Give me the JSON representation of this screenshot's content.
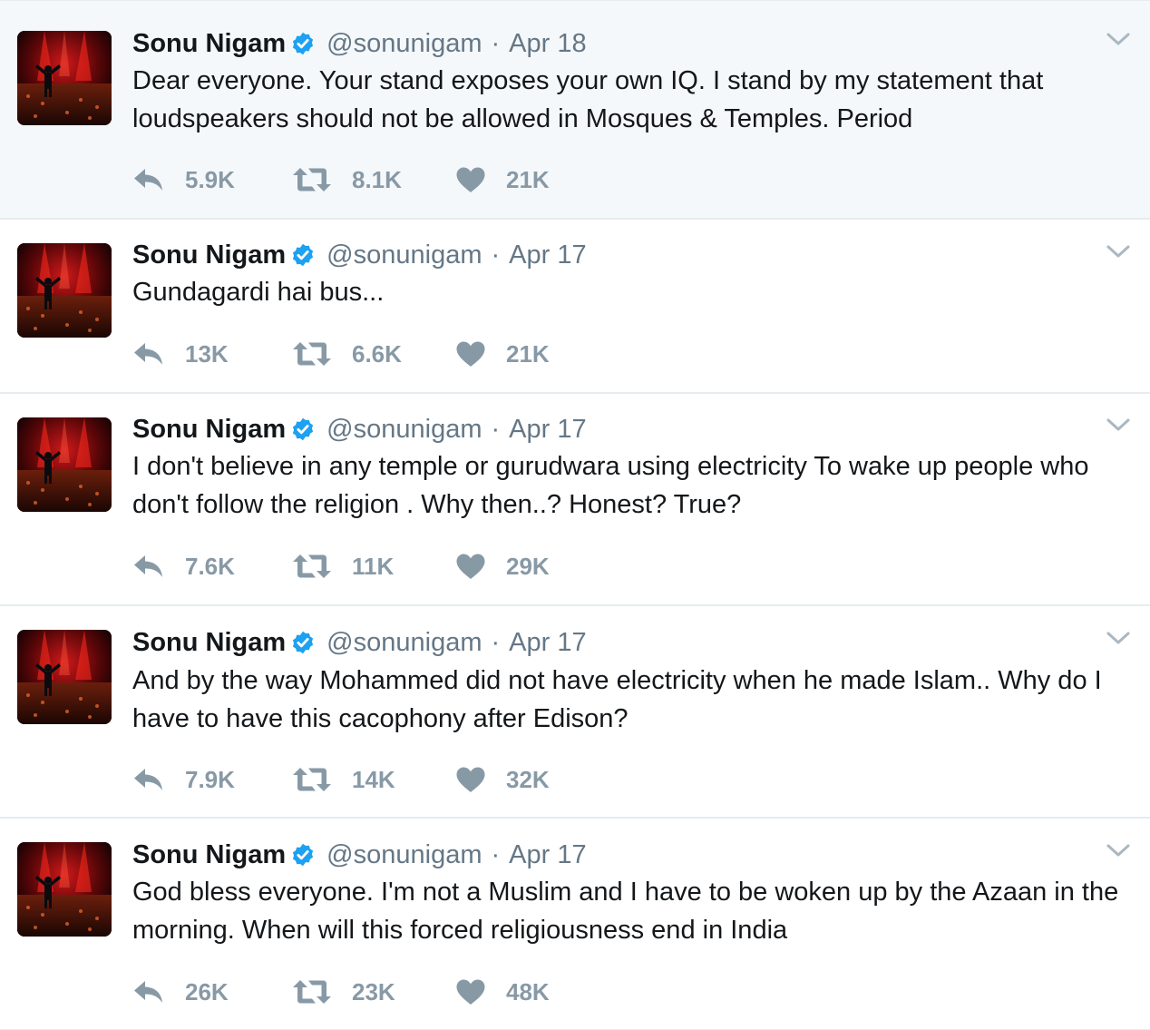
{
  "tweets": [
    {
      "name": "Sonu Nigam",
      "handle": "@sonunigam",
      "separator": "·",
      "date": "Apr 18",
      "text": "Dear everyone. Your stand exposes your own IQ. I stand by my statement that loudspeakers should not be allowed in Mosques & Temples. Period",
      "replies": "5.9K",
      "retweets": "8.1K",
      "likes": "21K",
      "highlighted": true
    },
    {
      "name": "Sonu Nigam",
      "handle": "@sonunigam",
      "separator": "·",
      "date": "Apr 17",
      "text": "Gundagardi hai bus...",
      "replies": "13K",
      "retweets": "6.6K",
      "likes": "21K",
      "highlighted": false
    },
    {
      "name": "Sonu Nigam",
      "handle": "@sonunigam",
      "separator": "·",
      "date": "Apr 17",
      "text": "I don't believe in any temple or gurudwara using electricity To wake up people who don't follow the religion . Why then..? Honest? True?",
      "replies": "7.6K",
      "retweets": "11K",
      "likes": "29K",
      "highlighted": false
    },
    {
      "name": "Sonu Nigam",
      "handle": "@sonunigam",
      "separator": "·",
      "date": "Apr 17",
      "text": "And by the way Mohammed did not have electricity when he made Islam.. Why do I have to have this cacophony after Edison?",
      "replies": "7.9K",
      "retweets": "14K",
      "likes": "32K",
      "highlighted": false
    },
    {
      "name": "Sonu Nigam",
      "handle": "@sonunigam",
      "separator": "·",
      "date": "Apr 17",
      "text": "God bless everyone. I'm not a Muslim and I have to be woken up by the Azaan in the morning. When will this forced religiousness end in India",
      "replies": "26K",
      "retweets": "23K",
      "likes": "48K",
      "highlighted": false
    }
  ],
  "icons": {
    "verified": "verified-badge-icon",
    "reply": "reply-icon",
    "retweet": "retweet-icon",
    "like": "heart-icon",
    "caret": "chevron-down-icon"
  },
  "colors": {
    "verified_blue": "#1da1f2",
    "muted_text": "#657786",
    "action_gray": "#8899a6",
    "highlight_bg": "#f5f8fa",
    "divider": "#e6ecf0"
  }
}
